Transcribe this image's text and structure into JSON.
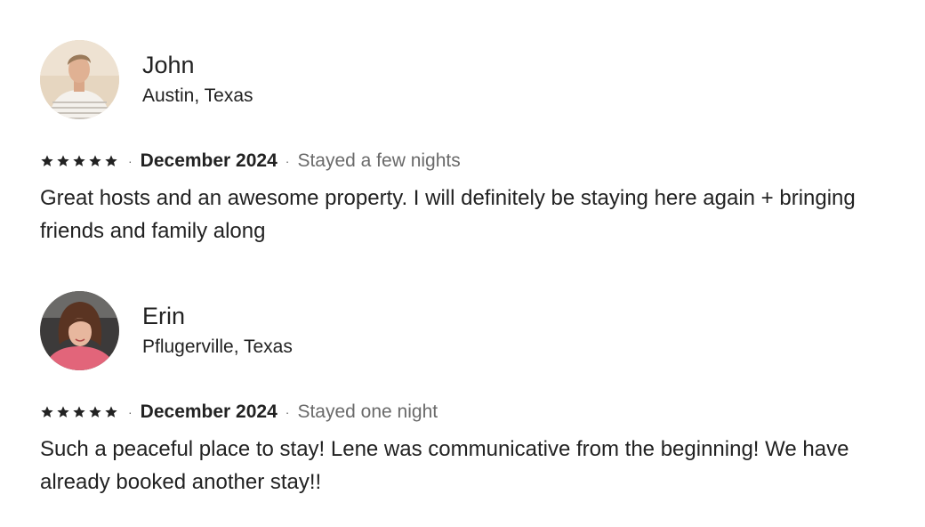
{
  "reviews": [
    {
      "name": "John",
      "location": "Austin, Texas",
      "rating": 5,
      "separator": "·",
      "date": "December 2024",
      "stay": "Stayed a few nights",
      "text": "Great hosts and an awesome property. I will definitely be staying here again + bringing friends and family along"
    },
    {
      "name": "Erin",
      "location": "Pflugerville, Texas",
      "rating": 5,
      "separator": "·",
      "date": "December 2024",
      "stay": "Stayed one night",
      "text": "Such a peaceful place to stay! Lene was communicative from the beginning! We have already booked another stay!!"
    }
  ],
  "colors": {
    "text_primary": "#222222",
    "text_secondary": "#6a6a6a",
    "star": "#222222"
  }
}
